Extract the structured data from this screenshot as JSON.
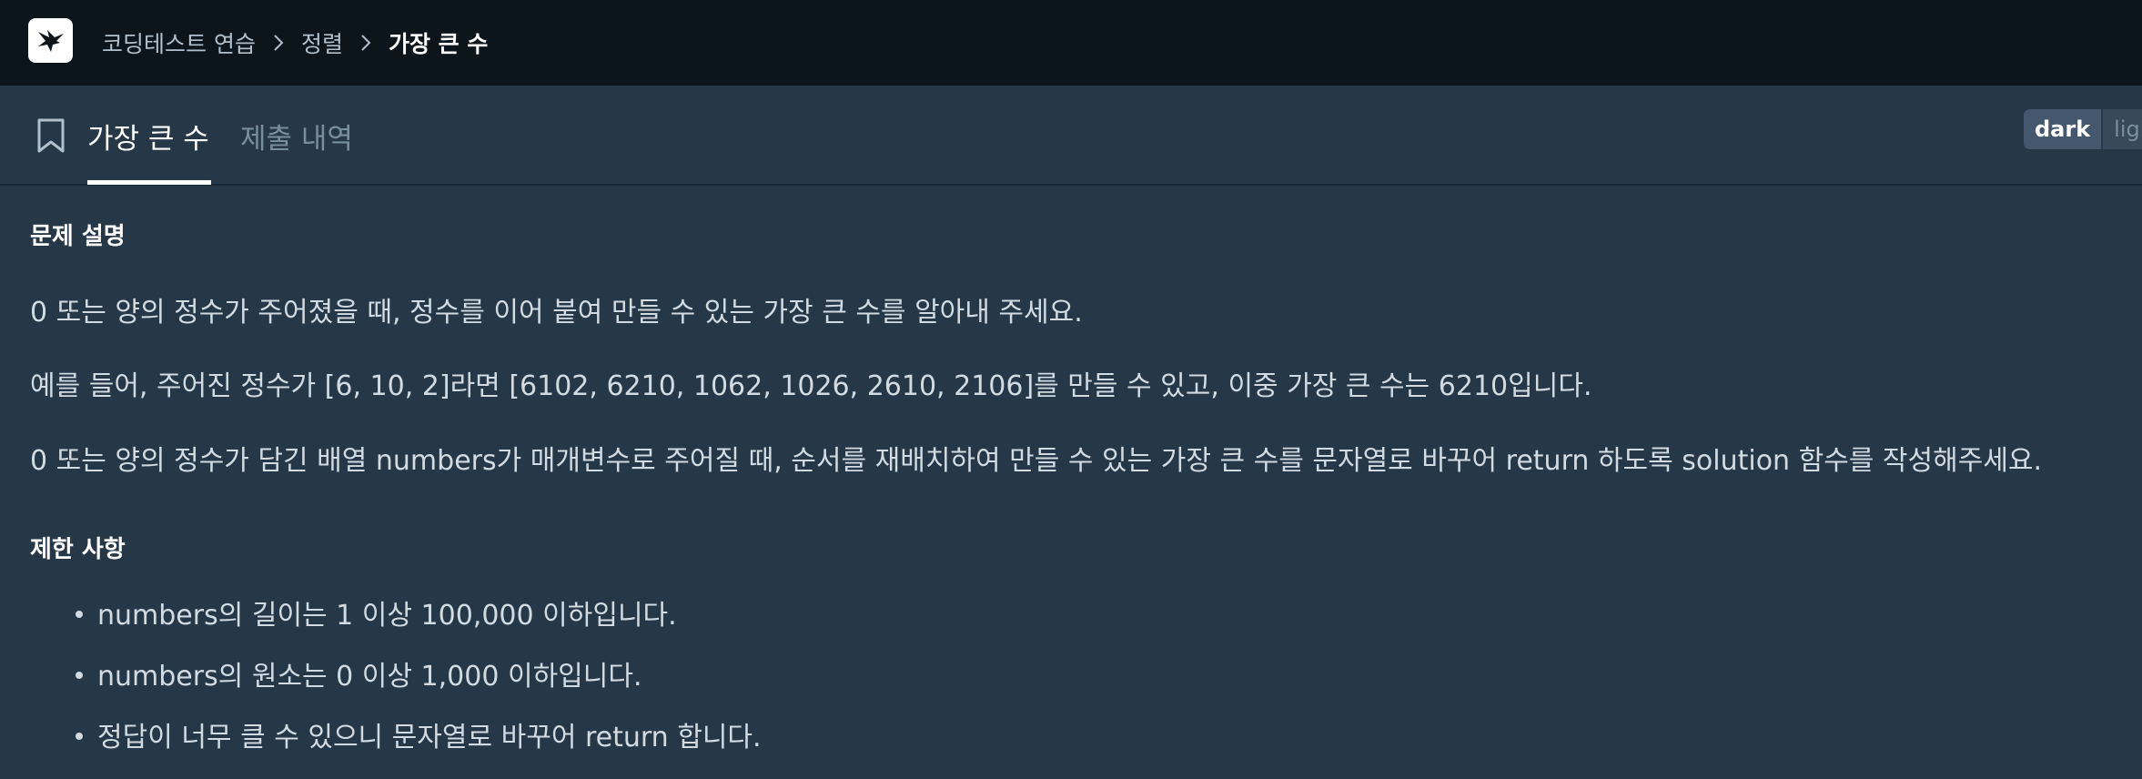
{
  "header": {
    "logo_icon": "programmers-bird-logo-icon",
    "breadcrumb": [
      "코딩테스트 연습",
      "정렬"
    ],
    "breadcrumb_current": "가장 큰 수"
  },
  "tabs": {
    "bookmark_icon": "bookmark-icon",
    "active_label": "가장 큰 수",
    "inactive_label": "제출 내역"
  },
  "theme": {
    "dark_label": "dark",
    "light_label": "light"
  },
  "problem": {
    "description_title": "문제 설명",
    "paragraphs": [
      "0 또는 양의 정수가 주어졌을 때, 정수를 이어 붙여 만들 수 있는 가장 큰 수를 알아내 주세요.",
      "예를 들어, 주어진 정수가 [6, 10, 2]라면 [6102, 6210, 1062, 1026, 2610, 2106]를 만들 수 있고, 이중 가장 큰 수는 6210입니다.",
      "0 또는 양의 정수가 담긴 배열 numbers가 매개변수로 주어질 때, 순서를 재배치하여 만들 수 있는 가장 큰 수를 문자열로 바꾸어 return 하도록 solution 함수를 작성해주세요."
    ],
    "constraints_title": "제한 사항",
    "constraints": [
      "numbers의 길이는 1 이상 100,000 이하입니다.",
      "numbers의 원소는 0 이상 1,000 이하입니다.",
      "정답이 너무 클 수 있으니 문자열로 바꾸어 return 합니다."
    ]
  },
  "colors": {
    "topbar_bg": "#0c151c",
    "content_bg": "#263747",
    "text": "#d3dbe2",
    "muted": "#78909c"
  }
}
